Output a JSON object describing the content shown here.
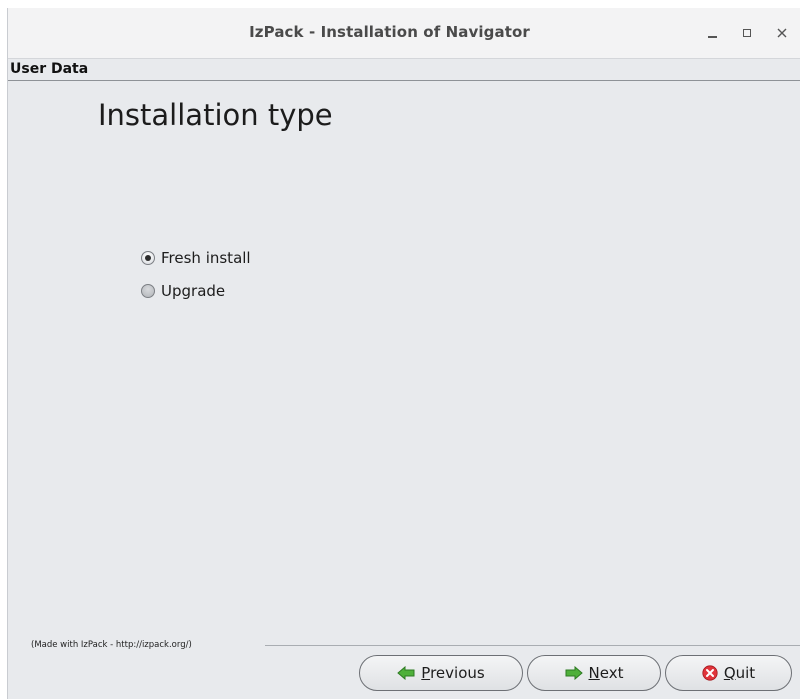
{
  "window": {
    "title": "IzPack - Installation of  Navigator",
    "controls": {
      "minimize": "minimize-icon",
      "maximize": "maximize-icon",
      "close": "close-icon"
    }
  },
  "panel": {
    "header": "User Data",
    "title": "Installation type",
    "options": [
      {
        "label": "Fresh install",
        "selected": true
      },
      {
        "label": "Upgrade",
        "selected": false
      }
    ]
  },
  "footer": {
    "made_with": "(Made with IzPack - http://izpack.org/)",
    "buttons": {
      "previous": {
        "mnemonic": "P",
        "rest": "revious",
        "icon": "arrow-left-icon",
        "icon_color": "#3c9a2c"
      },
      "next": {
        "mnemonic": "N",
        "rest": "ext",
        "icon": "arrow-right-icon",
        "icon_color": "#3c9a2c"
      },
      "quit": {
        "mnemonic": "Q",
        "rest": "uit",
        "icon": "quit-icon",
        "icon_color": "#d8262e"
      }
    }
  }
}
